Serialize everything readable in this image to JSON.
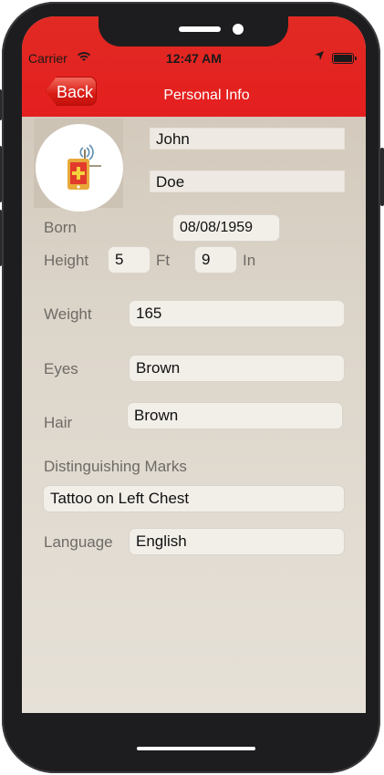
{
  "status_bar": {
    "carrier": "Carrier",
    "time": "12:47 AM"
  },
  "nav": {
    "back_label": "Back",
    "title": "Personal Info"
  },
  "name": {
    "first": "John",
    "last": "Doe"
  },
  "born": {
    "label": "Born",
    "value": "08/08/1959"
  },
  "height": {
    "label": "Height",
    "feet": "5",
    "feet_unit": "Ft",
    "inches": "9",
    "inches_unit": "In"
  },
  "weight": {
    "label": "Weight",
    "value": "165"
  },
  "eyes": {
    "label": "Eyes",
    "value": "Brown"
  },
  "hair": {
    "label": "Hair",
    "value": "Brown"
  },
  "marks": {
    "label": "Distinguishing Marks",
    "value": "Tattoo on Left Chest"
  },
  "language": {
    "label": "Language",
    "value": "English"
  },
  "colors": {
    "header_red": "#e41f1f",
    "back_button": "#d91c15",
    "label_gray": "#6e6a66"
  },
  "icons": {
    "avatar": "medical-device-icon",
    "wifi": "wifi-icon",
    "location": "location-arrow-icon",
    "battery": "battery-icon"
  }
}
